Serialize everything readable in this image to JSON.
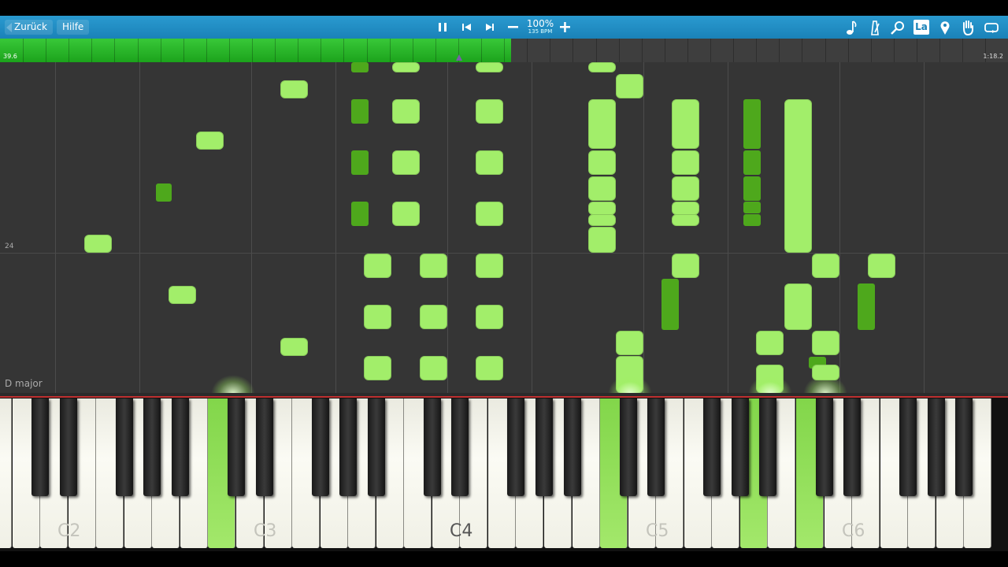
{
  "toolbar": {
    "back_label": "Zurück",
    "help_label": "Hilfe",
    "speed_percent": "100%",
    "tempo": "135 BPM",
    "icons": [
      "pause-icon",
      "skip-back-icon",
      "skip-forward-icon",
      "minus-icon",
      "plus-icon",
      "note-icon",
      "metronome-icon",
      "magnifier-icon",
      "label-icon",
      "marker-icon",
      "hand-icon",
      "loop-icon"
    ],
    "label_icon_text": "La",
    "accent": "#1a82b8"
  },
  "timeline": {
    "current_time": "39.6",
    "total_time": "1:18.2",
    "progress": 0.507,
    "fill_color": "#2bb82b"
  },
  "roll": {
    "measure_number": "24",
    "key_signature": "D major",
    "light_note_color": "#a2ee6a",
    "dark_note_color": "#4ea81c"
  },
  "keyboard": {
    "octave_labels": [
      "C2",
      "C3",
      "C4",
      "C5",
      "C6"
    ],
    "active_color": "#8fdc55"
  }
}
